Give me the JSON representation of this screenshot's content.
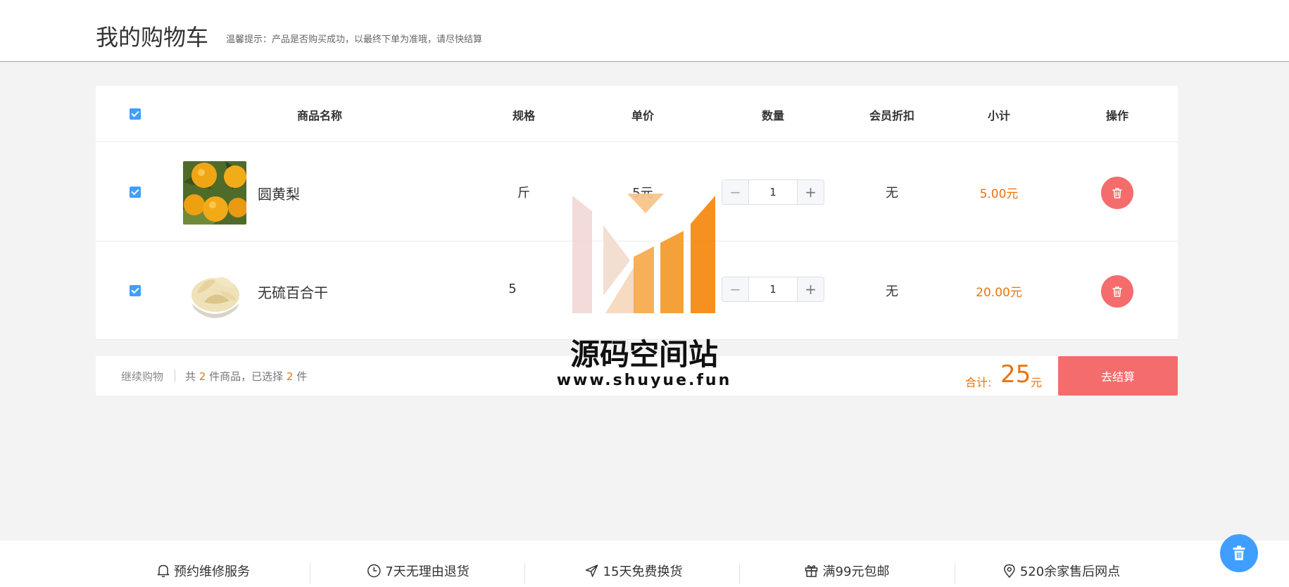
{
  "header": {
    "title": "我的购物车",
    "tip": "温馨提示：产品是否购买成功，以最终下单为准哦，请尽快结算"
  },
  "table": {
    "columns": {
      "name": "商品名称",
      "spec": "规格",
      "price": "单价",
      "quantity": "数量",
      "discount": "会员折扣",
      "subtotal": "小计",
      "action": "操作"
    },
    "rows": [
      {
        "checked": true,
        "name": "圆黄梨",
        "spec": "斤",
        "price": "5元",
        "quantity": "1",
        "discount": "无",
        "subtotal": "5.00元"
      },
      {
        "checked": true,
        "name": "无硫百合干",
        "spec": "5",
        "price": "",
        "quantity": "1",
        "discount": "无",
        "subtotal": "20.00元"
      }
    ]
  },
  "summary": {
    "continue_label": "继续购物",
    "count_prefix": "共",
    "total_items": "2",
    "count_middle": "件商品，已选择",
    "selected_items": "2",
    "count_suffix": "件",
    "total_label": "合计:",
    "total_value": "25",
    "total_unit": "元",
    "checkout_label": "去结算"
  },
  "services": [
    {
      "icon": "bell-icon",
      "label": "预约维修服务"
    },
    {
      "icon": "clock-icon",
      "label": "7天无理由退货"
    },
    {
      "icon": "send-icon",
      "label": "15天免费换货"
    },
    {
      "icon": "gift-icon",
      "label": "满99元包邮"
    },
    {
      "icon": "location-pin-icon",
      "label": "520余家售后网点"
    }
  ],
  "watermark": {
    "title": "源码空间站",
    "url": "www.shuyue.fun"
  },
  "colors": {
    "accent_orange": "#e8740f",
    "delete_red": "#f56c6c",
    "checkbox_blue": "#409eff",
    "header_border": "#d5a05a"
  }
}
